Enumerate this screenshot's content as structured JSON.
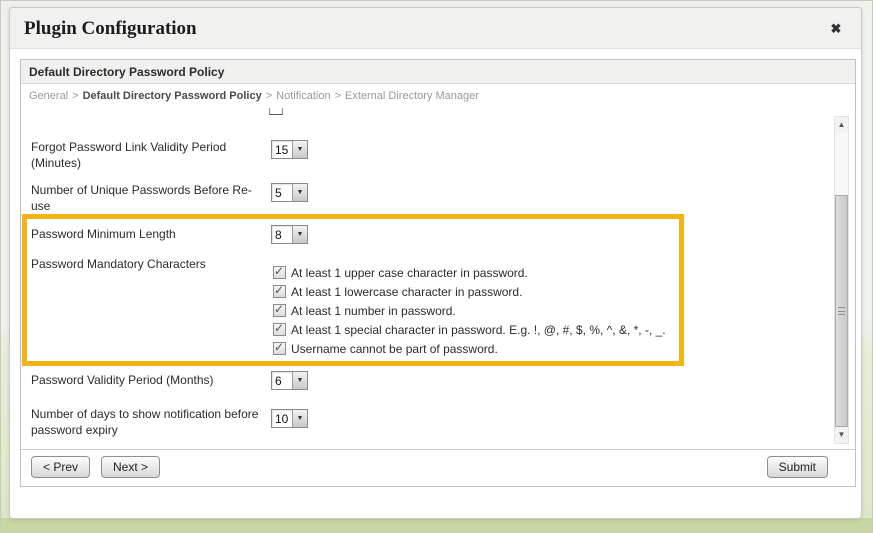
{
  "dialog": {
    "title": "Plugin Configuration",
    "close_glyph": "✖"
  },
  "panel": {
    "title": "Default Directory Password Policy"
  },
  "breadcrumb": {
    "separator": ">",
    "items": [
      {
        "label": "General"
      },
      {
        "label": "Default Directory Password Policy"
      },
      {
        "label": "Notification"
      },
      {
        "label": "External Directory Manager"
      }
    ]
  },
  "form": {
    "forgot_link": {
      "label": "Forgot Password Link Validity Period (Minutes)",
      "value": "15"
    },
    "unique_passwords": {
      "label": "Number of Unique Passwords Before Re-use",
      "value": "5"
    },
    "min_length": {
      "label": "Password Minimum Length",
      "value": "8"
    },
    "mandatory_chars": {
      "label": "Password Mandatory Characters",
      "checkboxes": [
        {
          "label": "At least 1 upper case character in password.",
          "checked": true
        },
        {
          "label": "At least 1 lowercase character in password.",
          "checked": true
        },
        {
          "label": "At least 1 number in password.",
          "checked": true
        },
        {
          "label": "At least 1 special character in password. E.g. !, @, #, $, %, ^, &, *, -, _.",
          "checked": true
        },
        {
          "label": "Username cannot be part of password.",
          "checked": true
        }
      ]
    },
    "validity_period": {
      "label": "Password Validity Period (Months)",
      "value": "6"
    },
    "notification_days": {
      "label": "Number of days to show notification before password expiry",
      "value": "10"
    }
  },
  "buttons": {
    "prev": "< Prev",
    "next": "Next >",
    "submit": "Submit"
  },
  "glyphs": {
    "select_arrow": "▼",
    "check": "✓",
    "scroll_up": "▲",
    "scroll_down": "▼"
  },
  "colors": {
    "highlight_border": "#F2B414",
    "footer_band": "#c6d8a0"
  }
}
